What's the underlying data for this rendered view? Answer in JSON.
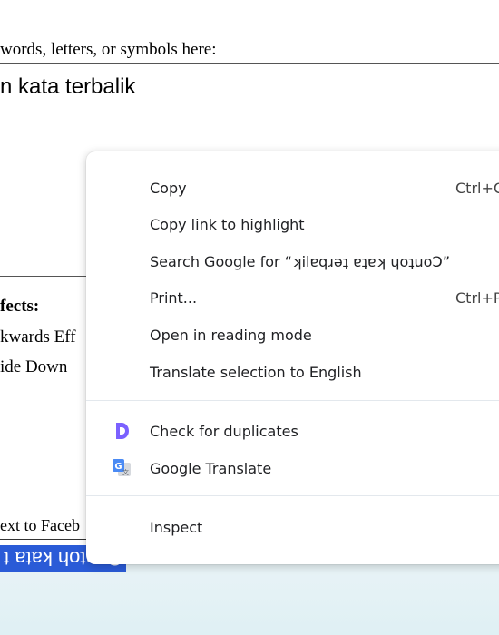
{
  "page": {
    "prompt": "words, letters, or symbols here:",
    "input_text": "n kata terbalik",
    "effects_label": "fects:",
    "effects": [
      "kwards Eff",
      "ide Down "
    ],
    "facebook_text": "ext to Faceb",
    "output_text": "Contoh kata t"
  },
  "context_menu": {
    "copy": "Copy",
    "copy_shortcut": "Ctrl+C",
    "copy_link": "Copy link to highlight",
    "search_google": "Search Google for “ʞilɐqɹǝʇ ɐʇɐʞ ɥoʇuoƆ”",
    "print": "Print...",
    "print_shortcut": "Ctrl+P",
    "reading_mode": "Open in reading mode",
    "translate_selection": "Translate selection to English",
    "check_duplicates": "Check for duplicates",
    "google_translate": "Google Translate",
    "inspect": "Inspect"
  },
  "colors": {
    "selection": "#2a5bd7",
    "duplicates_icon": "#7b61ff",
    "translate_icon": "#4a8af4"
  }
}
